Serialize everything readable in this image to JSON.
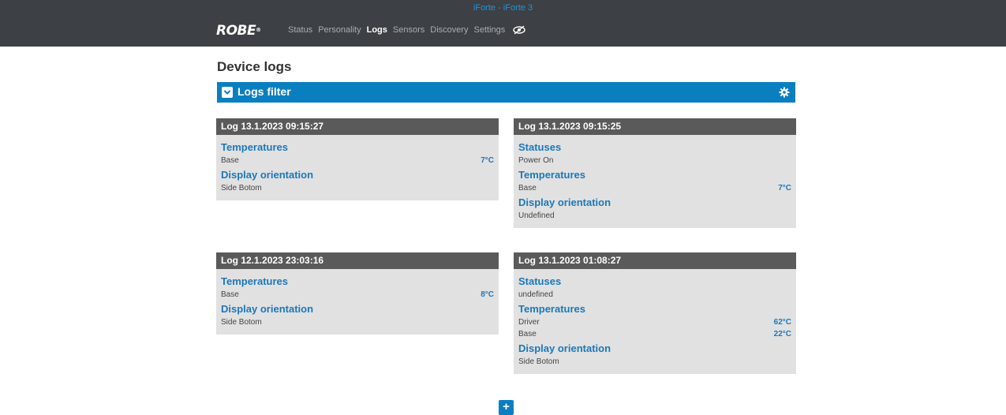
{
  "window": {
    "title": "iForte - iForte 3"
  },
  "brand": {
    "logo_text": "ROBE",
    "logo_mark": "®"
  },
  "nav": {
    "items": [
      {
        "label": "Status"
      },
      {
        "label": "Personality"
      },
      {
        "label": "Logs"
      },
      {
        "label": "Sensors"
      },
      {
        "label": "Discovery"
      },
      {
        "label": "Settings"
      }
    ],
    "active": "Logs"
  },
  "page": {
    "title": "Device logs"
  },
  "filter": {
    "label": "Logs filter"
  },
  "logs": [
    {
      "header": "Log 13.1.2023 09:15:27",
      "sections": [
        {
          "title": "Temperatures",
          "rows": [
            {
              "label": "Base",
              "value": "7°C"
            }
          ]
        },
        {
          "title": "Display orientation",
          "rows": [
            {
              "label": "Side Botom",
              "value": ""
            }
          ]
        }
      ]
    },
    {
      "header": "Log 13.1.2023 09:15:25",
      "sections": [
        {
          "title": "Statuses",
          "rows": [
            {
              "label": "Power On",
              "value": ""
            }
          ]
        },
        {
          "title": "Temperatures",
          "rows": [
            {
              "label": "Base",
              "value": "7°C"
            }
          ]
        },
        {
          "title": "Display orientation",
          "rows": [
            {
              "label": "Undefined",
              "value": ""
            }
          ]
        }
      ]
    },
    {
      "header": "Log 12.1.2023 23:03:16",
      "sections": [
        {
          "title": "Temperatures",
          "rows": [
            {
              "label": "Base",
              "value": "8°C"
            }
          ]
        },
        {
          "title": "Display orientation",
          "rows": [
            {
              "label": "Side Botom",
              "value": ""
            }
          ]
        }
      ]
    },
    {
      "header": "Log 13.1.2023 01:08:27",
      "sections": [
        {
          "title": "Statuses",
          "rows": [
            {
              "label": "undefined",
              "value": ""
            }
          ]
        },
        {
          "title": "Temperatures",
          "rows": [
            {
              "label": "Driver",
              "value": "62°C"
            },
            {
              "label": "Base",
              "value": "22°C"
            }
          ]
        },
        {
          "title": "Display orientation",
          "rows": [
            {
              "label": "Side Botom",
              "value": ""
            }
          ]
        }
      ]
    }
  ],
  "load_more": {
    "label": "+"
  },
  "colors": {
    "accent": "#0a7fc0",
    "header_bg": "#3d4044",
    "card_header": "#5a5a5a",
    "card_bg": "#e1e1e1"
  },
  "icons": {
    "view": "eye-icon",
    "filter_toggle": "chevron-down-icon",
    "settings": "gear-icon"
  }
}
